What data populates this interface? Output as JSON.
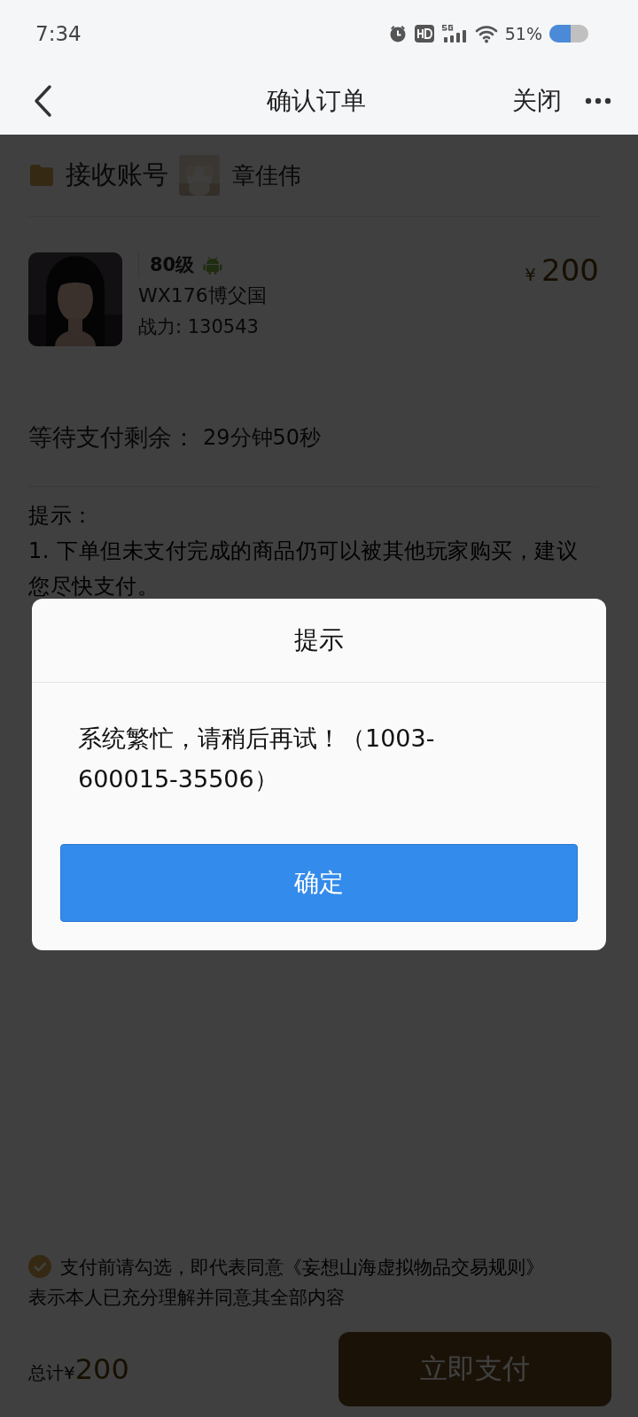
{
  "status_bar": {
    "time": "7:34",
    "battery_text": "51%"
  },
  "nav": {
    "title": "确认订单",
    "close": "关闭"
  },
  "receiver": {
    "label": "接收账号",
    "name": "章佳伟"
  },
  "item": {
    "grade": "80级",
    "server": "WX176博父国",
    "power": "战力: 130543",
    "currency": "¥",
    "price": "200"
  },
  "countdown": {
    "label": "等待支付剩余：",
    "value": "29分钟50秒"
  },
  "tips": {
    "title": "提示：",
    "lines": [
      "1. 下单但未支付完成的商品仍可以被其他玩家购买，建议您尽快支付。"
    ]
  },
  "agreement": {
    "checked": true,
    "text": "支付前请勾选，即代表同意",
    "link": "《妄想山海虚拟物品交易规则》",
    "note": "表示本人已充分理解并同意其全部内容"
  },
  "footer": {
    "total_label": "总计¥",
    "total": "200",
    "pay": "立即支付"
  },
  "dialog": {
    "title": "提示",
    "message": "系统繁忙，请稍后再试！（1003-600015-35506）",
    "ok": "确定"
  }
}
